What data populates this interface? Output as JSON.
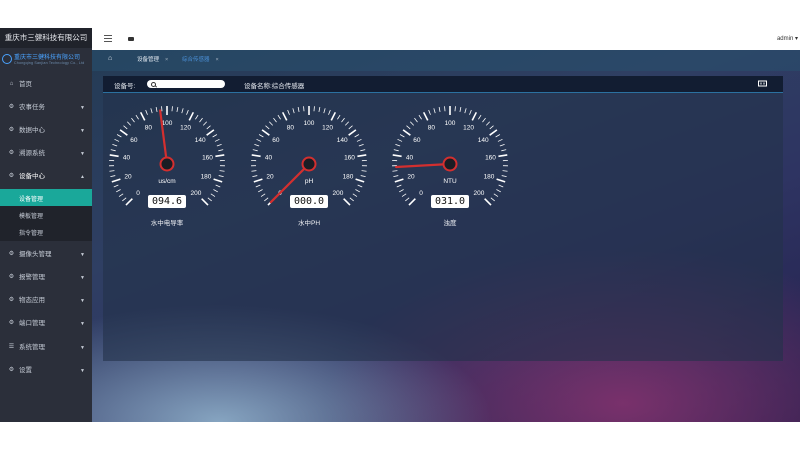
{
  "app": {
    "title": "重庆市三健科技有限公司"
  },
  "brand": {
    "name_cn": "重庆市三健科技有限公司",
    "name_en": "Chongqing Sanjian Technology Co., Ltd"
  },
  "sidebar": {
    "items": [
      {
        "label": "首页",
        "icon": "home-icon",
        "has_arrow": false
      },
      {
        "label": "农事任务",
        "icon": "gear-icon",
        "has_arrow": true
      },
      {
        "label": "数据中心",
        "icon": "gear-icon",
        "has_arrow": true
      },
      {
        "label": "溯源系统",
        "icon": "gear-icon",
        "has_arrow": true
      },
      {
        "label": "设备中心",
        "icon": "gear-icon",
        "has_arrow": true,
        "open": true
      },
      {
        "label": "摄像头管理",
        "icon": "gear-icon",
        "has_arrow": true
      },
      {
        "label": "报警管理",
        "icon": "gear-icon",
        "has_arrow": true
      },
      {
        "label": "物态应用",
        "icon": "gear-icon",
        "has_arrow": true
      },
      {
        "label": "端口管理",
        "icon": "gear-icon",
        "has_arrow": true
      },
      {
        "label": "系统管理",
        "icon": "list-icon",
        "has_arrow": true
      },
      {
        "label": "设置",
        "icon": "gear-icon",
        "has_arrow": true
      }
    ],
    "submenu": [
      {
        "label": "设备管理",
        "active": true
      },
      {
        "label": "模板管理",
        "active": false
      },
      {
        "label": "指令管理",
        "active": false
      }
    ]
  },
  "topbar": {
    "user": "admin"
  },
  "tabs": [
    {
      "label": "设备管理"
    },
    {
      "label": "综合传感器"
    }
  ],
  "panel": {
    "device_no_label": "设备号:",
    "search_placeholder": "",
    "device_name": "设备名称:综合传感器"
  },
  "gauges": [
    {
      "caption": "水中电导率",
      "unit": "us/cm",
      "value": 94.6,
      "display": "094.6",
      "ticks": [
        "0",
        "20",
        "40",
        "60",
        "80",
        "100",
        "120",
        "140",
        "160",
        "180",
        "200"
      ]
    },
    {
      "caption": "水中PH",
      "unit": "pH",
      "value": 0,
      "display": "000.0",
      "ticks": [
        "0",
        "20",
        "40",
        "60",
        "80",
        "100",
        "120",
        "140",
        "160",
        "180",
        "200"
      ]
    },
    {
      "caption": "浊度",
      "unit": "NTU",
      "value": 31.0,
      "display": "031.0",
      "ticks": [
        "0",
        "20",
        "40",
        "60",
        "80",
        "100",
        "120",
        "140",
        "160",
        "180",
        "200"
      ]
    }
  ],
  "colors": {
    "active": "#1aa89a",
    "needle": "#d32f2f",
    "sidebar": "#2b2f3a"
  }
}
